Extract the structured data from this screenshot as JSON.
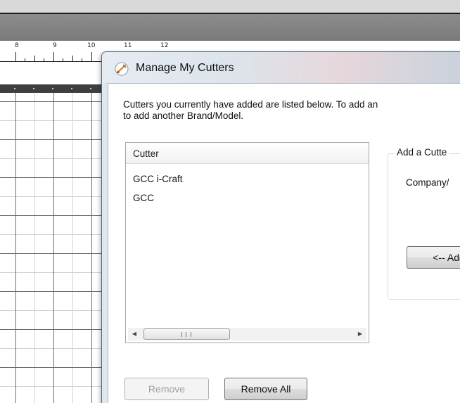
{
  "ruler": {
    "labels": [
      "8",
      "9",
      "10",
      "11",
      "12"
    ]
  },
  "dialog": {
    "title": "Manage My Cutters",
    "instructions_line1": "Cutters you currently have added are listed below. To add an",
    "instructions_line2": "to add another Brand/Model.",
    "cutter_list": {
      "header": "Cutter",
      "items": [
        "GCC i-Craft",
        "GCC"
      ]
    },
    "remove_label": "Remove",
    "remove_all_label": "Remove All",
    "add_group": {
      "title": "Add a Cutte",
      "company_label": "Company/",
      "model_label": "I",
      "add_button_label": "<-- Add"
    },
    "scrollbar": {
      "left_icon": "scroll-left-arrow",
      "right_icon": "scroll-right-arrow"
    }
  }
}
